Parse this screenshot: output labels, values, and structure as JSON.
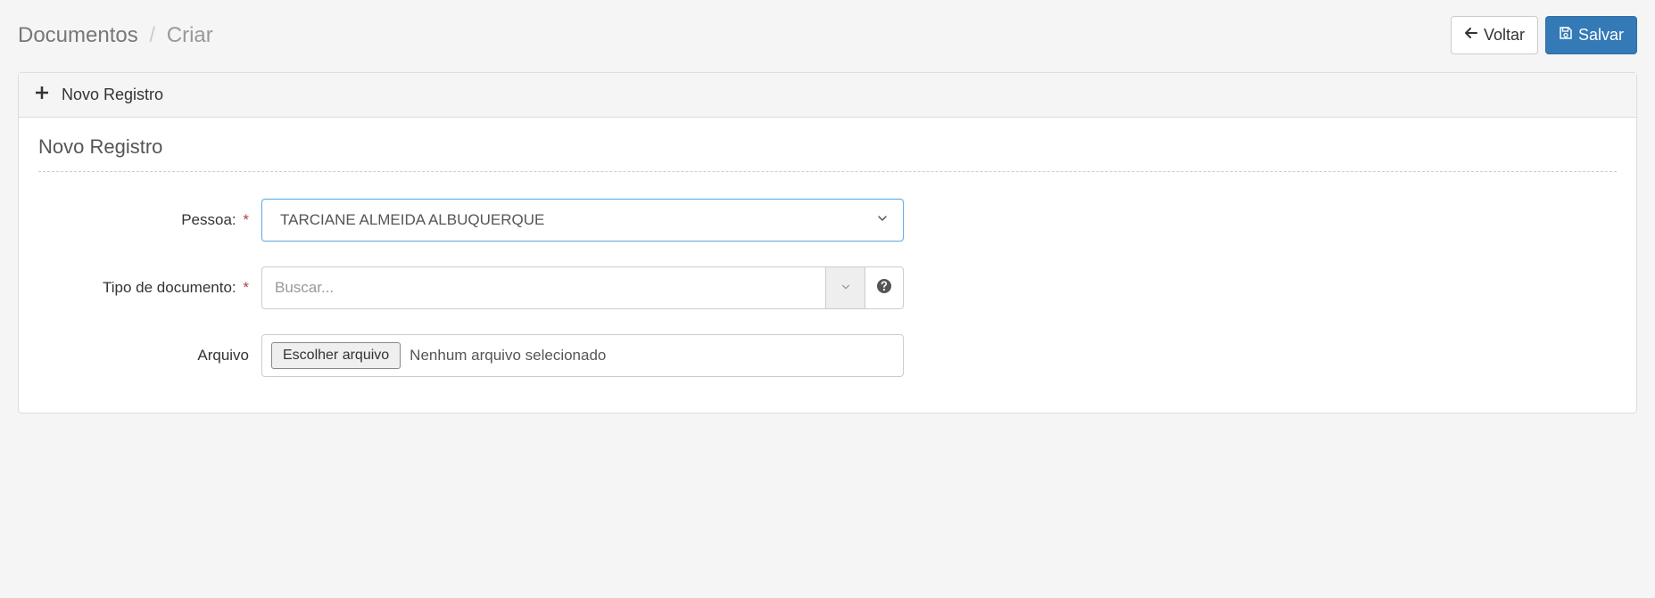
{
  "breadcrumb": {
    "root": "Documentos",
    "current": "Criar"
  },
  "header_buttons": {
    "back_label": "Voltar",
    "save_label": "Salvar"
  },
  "panel": {
    "heading": "Novo Registro",
    "section_title": "Novo Registro"
  },
  "form": {
    "pessoa": {
      "label": "Pessoa:",
      "value": "TARCIANE ALMEIDA ALBUQUERQUE"
    },
    "tipo_documento": {
      "label": "Tipo de documento:",
      "placeholder": "Buscar..."
    },
    "arquivo": {
      "label": "Arquivo",
      "choose_button": "Escolher arquivo",
      "status": "Nenhum arquivo selecionado"
    }
  }
}
